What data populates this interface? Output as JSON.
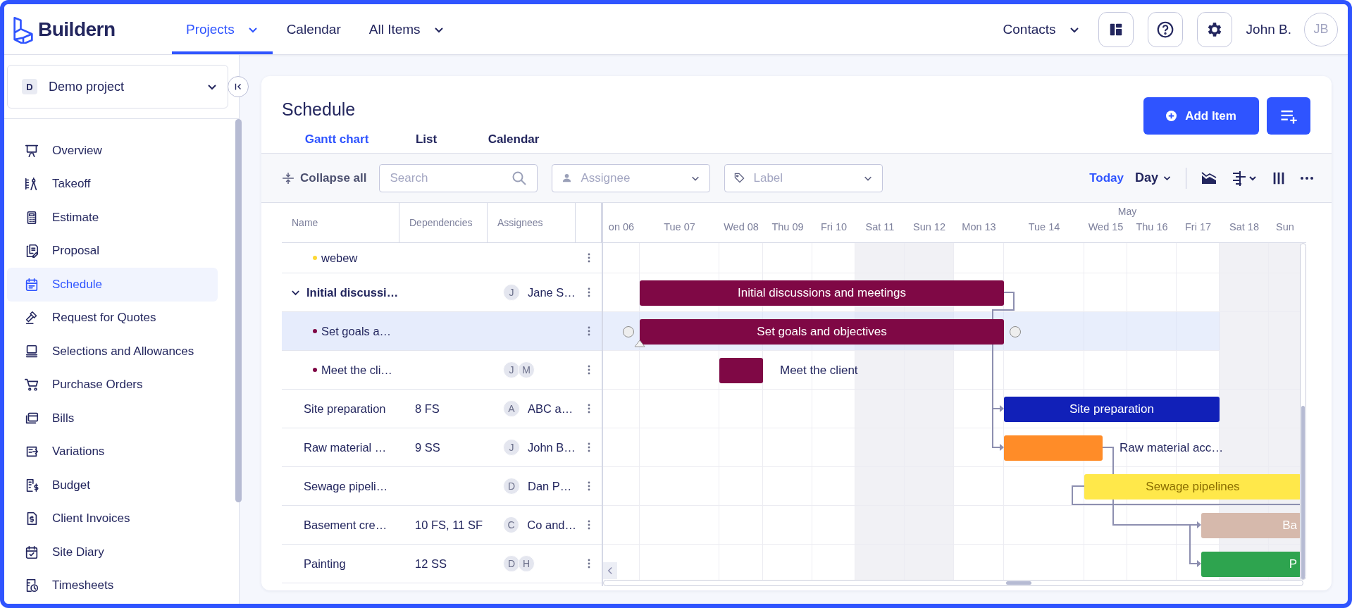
{
  "app": {
    "logo": "Buildern"
  },
  "nav": [
    {
      "label": "Projects",
      "selected": true,
      "dropdown": true
    },
    {
      "label": "Calendar",
      "selected": false,
      "dropdown": false
    },
    {
      "label": "All Items",
      "selected": false,
      "dropdown": true
    }
  ],
  "contacts": {
    "label": "Contacts",
    "dropdown": true
  },
  "user": {
    "name": "John B.",
    "initials": "JB"
  },
  "project_selector": {
    "badge": "D",
    "name": "Demo project"
  },
  "sidebar": {
    "items": [
      {
        "label": "Overview",
        "selected": false
      },
      {
        "label": "Takeoff",
        "selected": false
      },
      {
        "label": "Estimate",
        "selected": false
      },
      {
        "label": "Proposal",
        "selected": false
      },
      {
        "label": "Schedule",
        "selected": true
      },
      {
        "label": "Request for Quotes",
        "selected": false
      },
      {
        "label": "Selections and Allowances",
        "selected": false
      },
      {
        "label": "Purchase Orders",
        "selected": false
      },
      {
        "label": "Bills",
        "selected": false
      },
      {
        "label": "Variations",
        "selected": false
      },
      {
        "label": "Budget",
        "selected": false
      },
      {
        "label": "Client Invoices",
        "selected": false
      },
      {
        "label": "Site Diary",
        "selected": false
      },
      {
        "label": "Timesheets",
        "selected": false
      }
    ]
  },
  "page": {
    "title": "Schedule",
    "add_button": "Add Item",
    "tabs": [
      {
        "label": "Gantt chart",
        "selected": true
      },
      {
        "label": "List",
        "selected": false
      },
      {
        "label": "Calendar",
        "selected": false
      }
    ]
  },
  "toolbar": {
    "collapse": "Collapse all",
    "search": {
      "placeholder": "Search"
    },
    "assignee": {
      "placeholder": "Assignee"
    },
    "label": {
      "placeholder": "Label"
    },
    "today": "Today",
    "scale": "Day"
  },
  "table": {
    "columns": [
      "Name",
      "Dependencies",
      "Assignees"
    ],
    "rows": [
      {
        "kind": "subtask",
        "name": "webew",
        "color": "#fdd835",
        "selected": false,
        "dependencies": "",
        "assignees": [],
        "assignee": ""
      },
      {
        "kind": "group",
        "name": "Initial discussi…",
        "expanded": true,
        "selected": false,
        "dependencies": "",
        "assignees": [
          "J"
        ],
        "assignee": "Jane S…",
        "bar": {
          "label": "Initial discussions and meetings",
          "color": "#7f0845",
          "label_outside": false
        }
      },
      {
        "kind": "subtask",
        "name": "Set goals a…",
        "color": "#7f0845",
        "selected": true,
        "dependencies": "",
        "assignees": [],
        "assignee": "",
        "bar": {
          "label": "Set goals and objectives",
          "color": "#7f0845",
          "label_outside": false
        }
      },
      {
        "kind": "subtask",
        "name": "Meet the cli…",
        "color": "#7f0845",
        "selected": false,
        "dependencies": "",
        "assignees": [
          "J",
          "M"
        ],
        "assignee": "",
        "bar": {
          "label": "Meet the client",
          "color": "#7f0845",
          "label_outside": true
        }
      },
      {
        "kind": "task",
        "name": "Site preparation",
        "selected": false,
        "dependencies": "8 FS",
        "assignees": [
          "A"
        ],
        "assignee": "ABC a…",
        "bar": {
          "label": "Site preparation",
          "color": "#1120b8",
          "label_outside": false
        }
      },
      {
        "kind": "task",
        "name": "Raw material …",
        "selected": false,
        "dependencies": "9 SS",
        "assignees": [
          "J"
        ],
        "assignee": "John B…",
        "bar": {
          "label": "Raw material acc…",
          "color": "#ff8c28",
          "label_outside": true
        }
      },
      {
        "kind": "task",
        "name": "Sewage pipeli…",
        "selected": false,
        "dependencies": "",
        "assignees": [
          "D"
        ],
        "assignee": "Dan P…",
        "bar": {
          "label": "Sewage pipelines",
          "color": "#ffe84a",
          "label_outside": false
        }
      },
      {
        "kind": "task",
        "name": "Basement cre…",
        "selected": false,
        "dependencies": "10 FS, 11 SF",
        "assignees": [
          "C"
        ],
        "assignee": "Co and…",
        "bar": {
          "label": "Ba",
          "color": "#d6b9ac",
          "label_outside": false
        }
      },
      {
        "kind": "task",
        "name": "Painting",
        "selected": false,
        "dependencies": "12 SS",
        "assignees": [
          "D",
          "H"
        ],
        "assignee": "",
        "bar": {
          "label": "P",
          "color": "#2ea44f",
          "label_outside": false
        }
      }
    ]
  },
  "timeline": {
    "month": "May",
    "days": [
      {
        "label": "on 06",
        "weekend": false
      },
      {
        "label": "Tue 07",
        "weekend": false
      },
      {
        "label": "Wed 08",
        "weekend": false
      },
      {
        "label": "Thu 09",
        "weekend": false
      },
      {
        "label": "Fri 10",
        "weekend": false
      },
      {
        "label": "Sat 11",
        "weekend": true
      },
      {
        "label": "Sun 12",
        "weekend": true
      },
      {
        "label": "Mon 13",
        "weekend": false
      },
      {
        "label": "Tue 14",
        "weekend": false
      },
      {
        "label": "Wed 15",
        "weekend": false
      },
      {
        "label": "Thu 16",
        "weekend": false
      },
      {
        "label": "Fri 17",
        "weekend": false
      },
      {
        "label": "Sat 18",
        "weekend": true
      },
      {
        "label": "Sun",
        "weekend": true
      }
    ]
  }
}
